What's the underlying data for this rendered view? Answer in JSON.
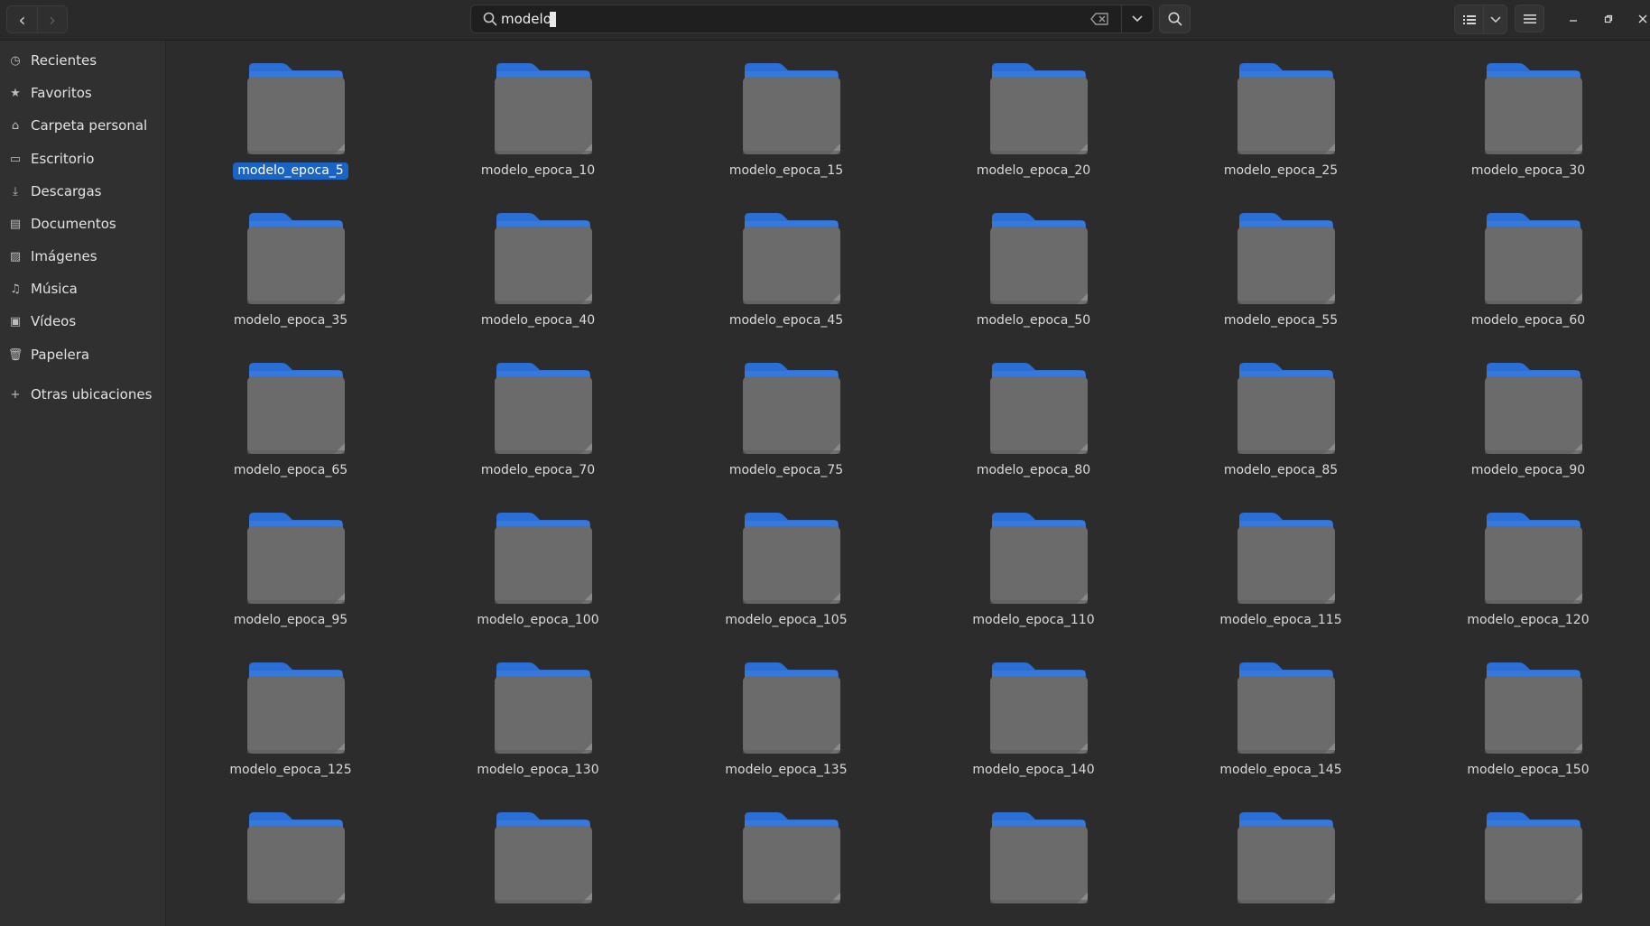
{
  "header": {
    "search_value": "modelo",
    "back_label": "‹",
    "forward_label": "›"
  },
  "sidebar": {
    "items": [
      {
        "label": "Recientes",
        "icon": "clock-icon",
        "glyph": "◷"
      },
      {
        "label": "Favoritos",
        "icon": "star-icon",
        "glyph": "★"
      },
      {
        "label": "Carpeta personal",
        "icon": "home-icon",
        "glyph": "⌂"
      },
      {
        "label": "Escritorio",
        "icon": "desktop-icon",
        "glyph": "▭"
      },
      {
        "label": "Descargas",
        "icon": "download-icon",
        "glyph": "⤓"
      },
      {
        "label": "Documentos",
        "icon": "document-icon",
        "glyph": "▤"
      },
      {
        "label": "Imágenes",
        "icon": "image-icon",
        "glyph": "▨"
      },
      {
        "label": "Música",
        "icon": "music-icon",
        "glyph": "♫"
      },
      {
        "label": "Vídeos",
        "icon": "video-icon",
        "glyph": "▣"
      },
      {
        "label": "Papelera",
        "icon": "trash-icon",
        "glyph": "🗑"
      },
      {
        "label": "Otras ubicaciones",
        "icon": "plus-icon",
        "glyph": "+"
      }
    ]
  },
  "content": {
    "folders": [
      "modelo_epoca_5",
      "modelo_epoca_10",
      "modelo_epoca_15",
      "modelo_epoca_20",
      "modelo_epoca_25",
      "modelo_epoca_30",
      "modelo_epoca_35",
      "modelo_epoca_40",
      "modelo_epoca_45",
      "modelo_epoca_50",
      "modelo_epoca_55",
      "modelo_epoca_60",
      "modelo_epoca_65",
      "modelo_epoca_70",
      "modelo_epoca_75",
      "modelo_epoca_80",
      "modelo_epoca_85",
      "modelo_epoca_90",
      "modelo_epoca_95",
      "modelo_epoca_100",
      "modelo_epoca_105",
      "modelo_epoca_110",
      "modelo_epoca_115",
      "modelo_epoca_120",
      "modelo_epoca_125",
      "modelo_epoca_130",
      "modelo_epoca_135",
      "modelo_epoca_140",
      "modelo_epoca_145",
      "modelo_epoca_150",
      "",
      "",
      "",
      "",
      "",
      ""
    ],
    "selected_index": 0
  },
  "colors": {
    "accent": "#1a64c5",
    "folder_tab": "#2b6fd6",
    "folder_body": "#6b6b6b"
  }
}
